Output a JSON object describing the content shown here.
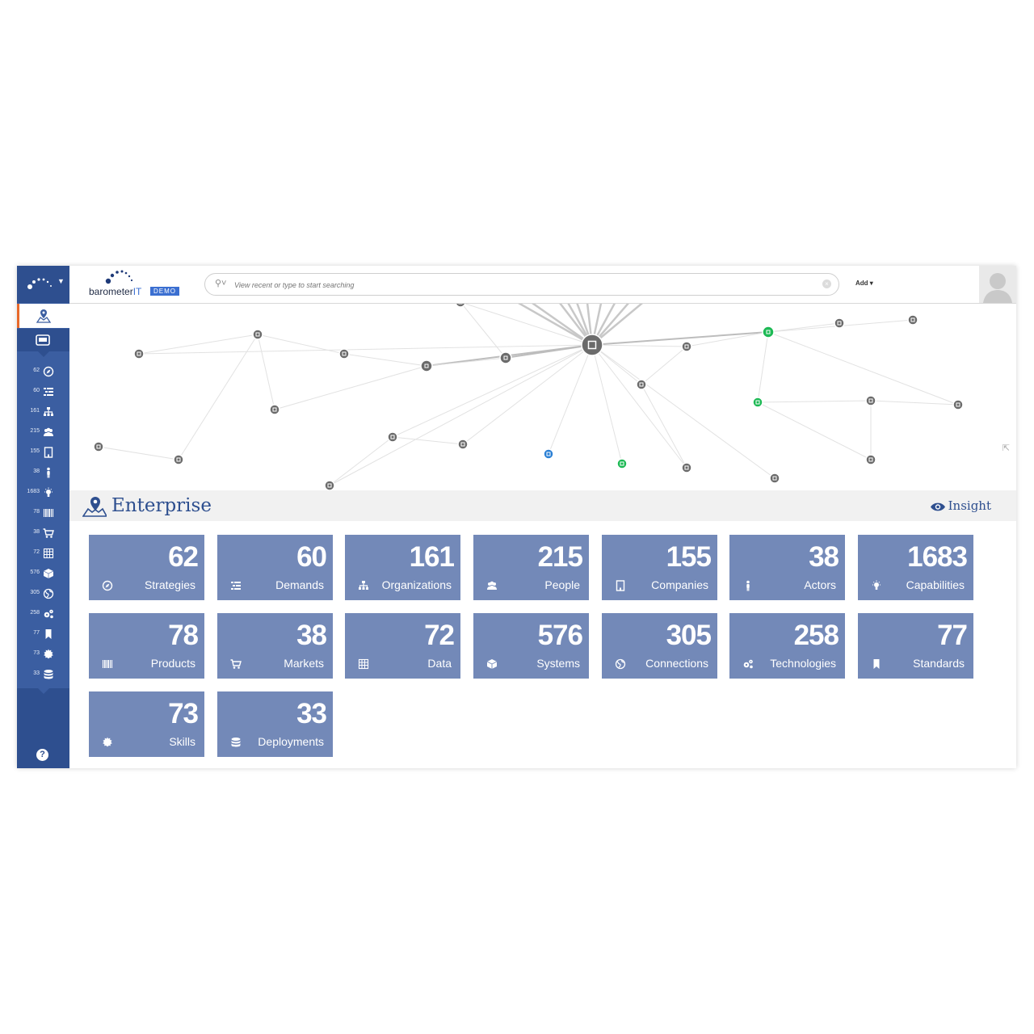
{
  "header": {
    "logo_word": "barometer",
    "logo_it": "IT",
    "logo_badge": "DEMO",
    "search_placeholder": "View recent or type to start searching",
    "add_label": "Add"
  },
  "section": {
    "title": "Enterprise",
    "insight_label": "Insight"
  },
  "colors": {
    "rail": "#3b5ea1",
    "rail_dark": "#2e4f8f",
    "tile": "#7389b8",
    "accent_orange": "#e8692a",
    "node_green": "#1db954",
    "node_blue": "#2a7fd4"
  },
  "tiles": [
    {
      "value": "62",
      "label": "Strategies",
      "icon": "compass-icon"
    },
    {
      "value": "60",
      "label": "Demands",
      "icon": "list-icon"
    },
    {
      "value": "161",
      "label": "Organizations",
      "icon": "sitemap-icon"
    },
    {
      "value": "215",
      "label": "People",
      "icon": "people-icon"
    },
    {
      "value": "155",
      "label": "Companies",
      "icon": "building-icon"
    },
    {
      "value": "38",
      "label": "Actors",
      "icon": "person-icon"
    },
    {
      "value": "1683",
      "label": "Capabilities",
      "icon": "lightbulb-icon"
    },
    {
      "value": "78",
      "label": "Products",
      "icon": "barcode-icon"
    },
    {
      "value": "38",
      "label": "Markets",
      "icon": "cart-icon"
    },
    {
      "value": "72",
      "label": "Data",
      "icon": "table-icon"
    },
    {
      "value": "576",
      "label": "Systems",
      "icon": "cube-icon"
    },
    {
      "value": "305",
      "label": "Connections",
      "icon": "globe-icon"
    },
    {
      "value": "258",
      "label": "Technologies",
      "icon": "gears-icon"
    },
    {
      "value": "77",
      "label": "Standards",
      "icon": "bookmark-icon"
    },
    {
      "value": "73",
      "label": "Skills",
      "icon": "badge-icon"
    },
    {
      "value": "33",
      "label": "Deployments",
      "icon": "database-icon"
    }
  ],
  "rail_items": [
    {
      "count": "62",
      "icon": "compass-icon"
    },
    {
      "count": "60",
      "icon": "list-icon"
    },
    {
      "count": "161",
      "icon": "sitemap-icon"
    },
    {
      "count": "215",
      "icon": "people-icon"
    },
    {
      "count": "155",
      "icon": "building-icon"
    },
    {
      "count": "38",
      "icon": "person-icon"
    },
    {
      "count": "1683",
      "icon": "lightbulb-icon"
    },
    {
      "count": "78",
      "icon": "barcode-icon"
    },
    {
      "count": "38",
      "icon": "cart-icon"
    },
    {
      "count": "72",
      "icon": "table-icon"
    },
    {
      "count": "576",
      "icon": "cube-icon"
    },
    {
      "count": "305",
      "icon": "globe-icon"
    },
    {
      "count": "258",
      "icon": "gears-icon"
    },
    {
      "count": "77",
      "icon": "bookmark-icon"
    },
    {
      "count": "73",
      "icon": "badge-icon"
    },
    {
      "count": "33",
      "icon": "database-icon"
    }
  ]
}
